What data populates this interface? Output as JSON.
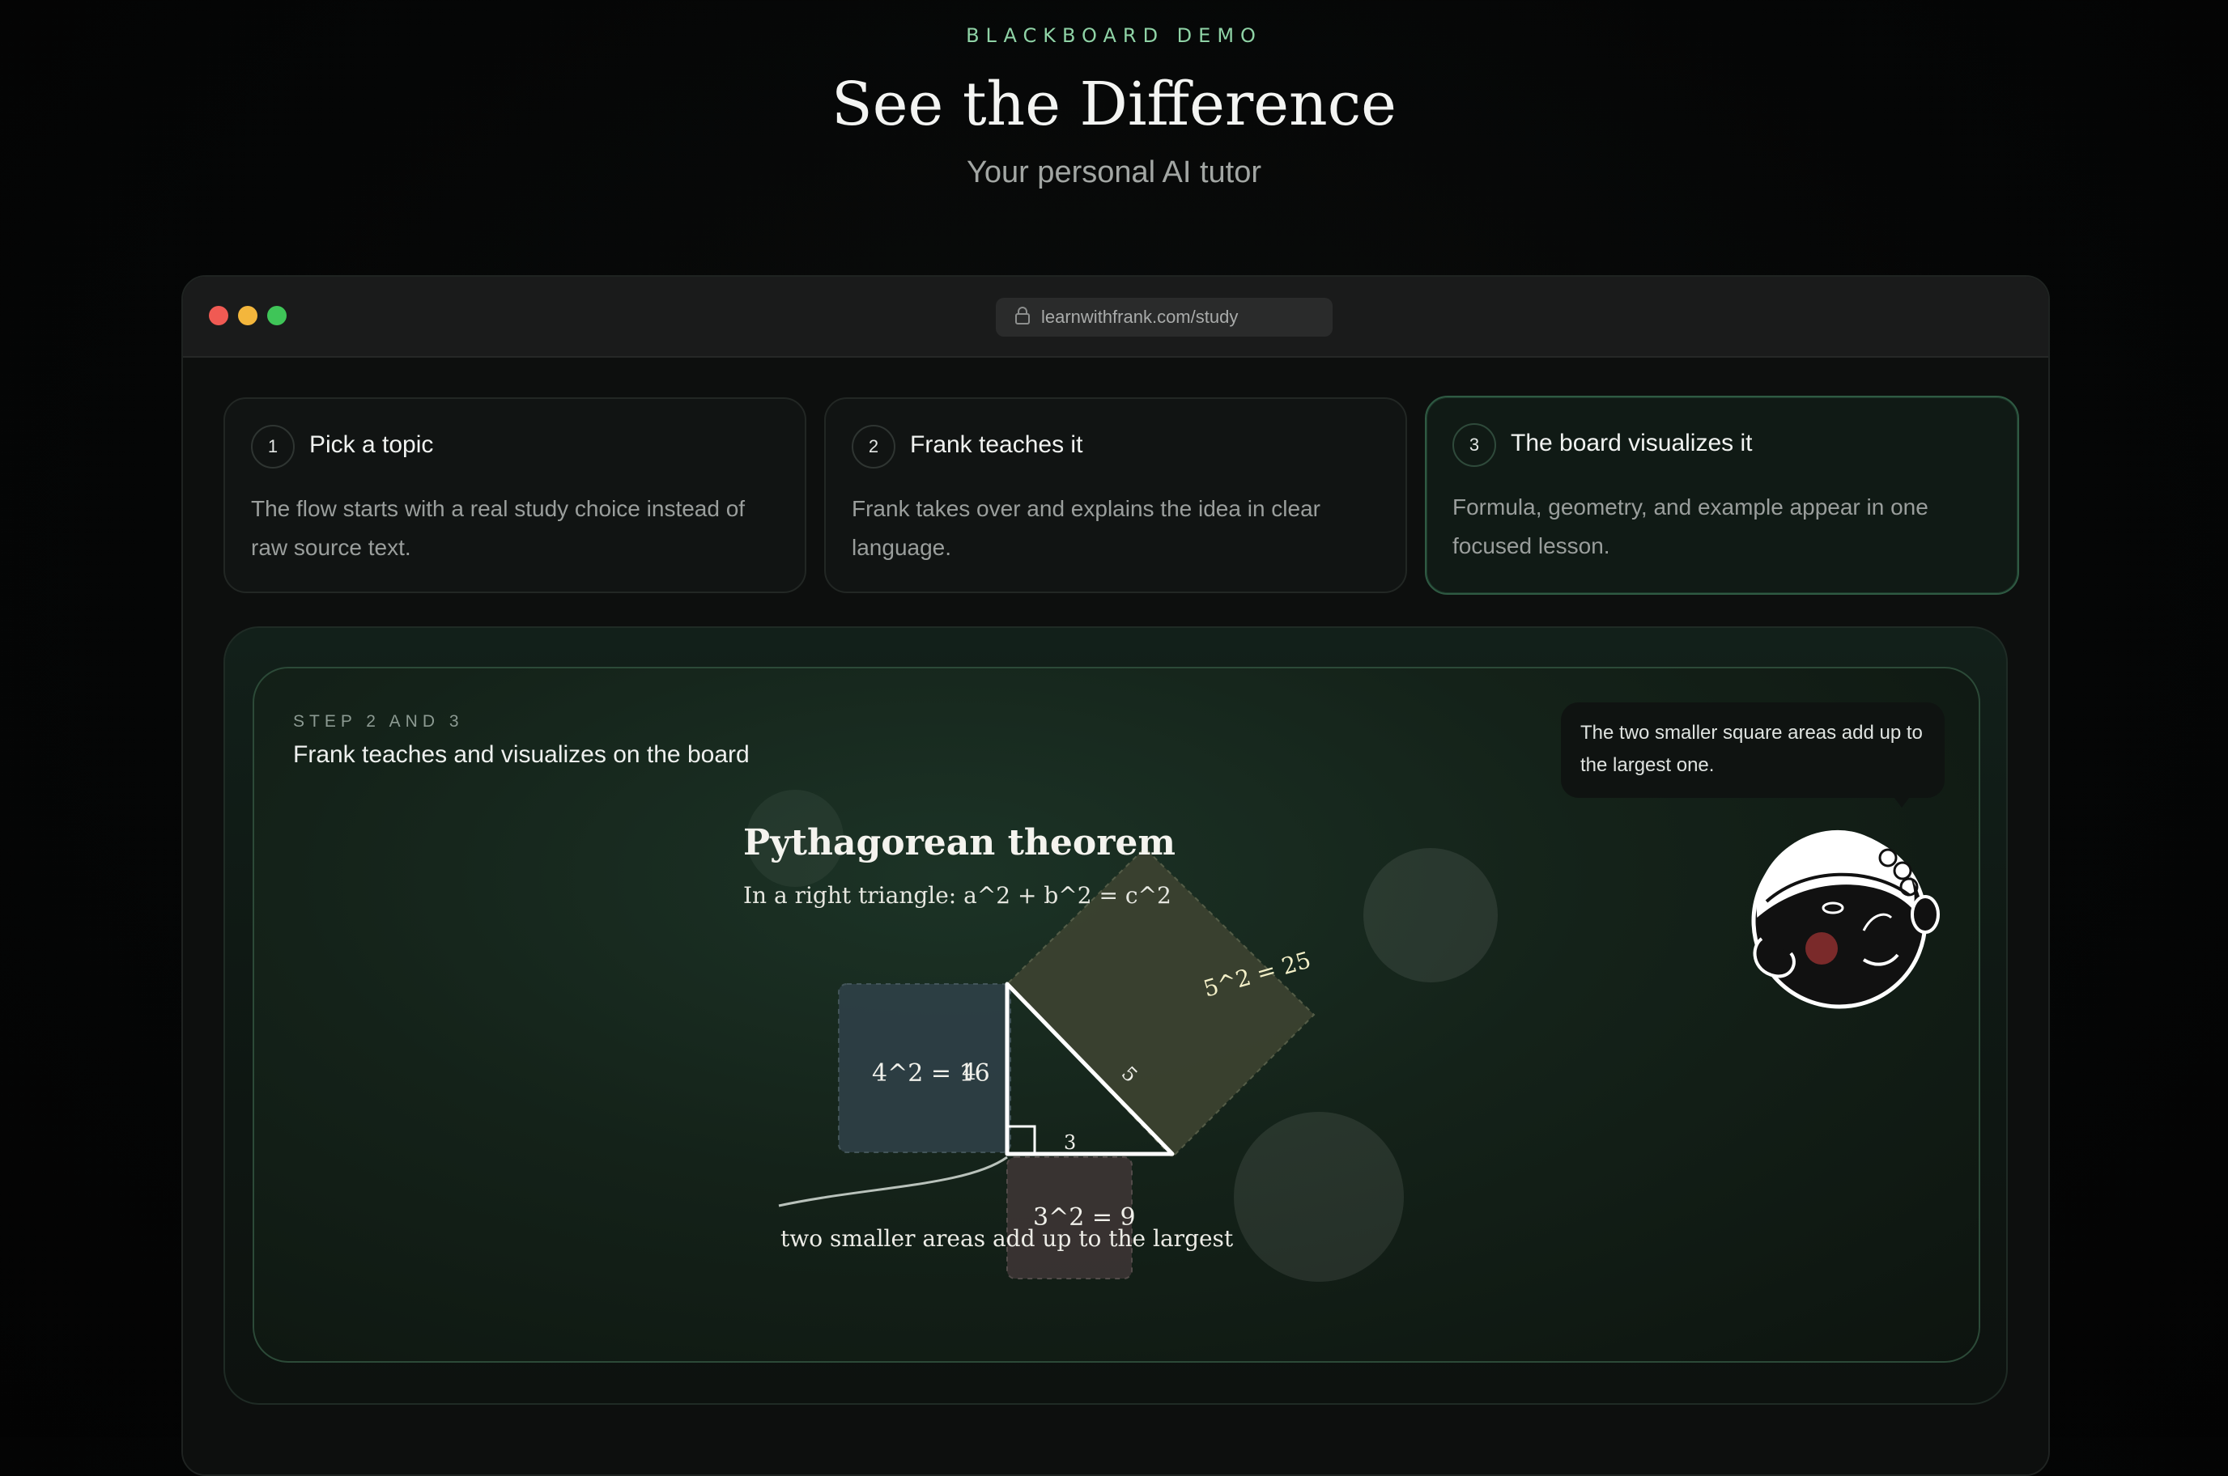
{
  "header": {
    "eyebrow": "BLACKBOARD DEMO",
    "title": "See the Difference",
    "subtitle": "Your personal AI tutor"
  },
  "browser": {
    "url": "learnwithfrank.com/study",
    "window_controls": [
      "close",
      "minimize",
      "maximize"
    ]
  },
  "steps": [
    {
      "number": "1",
      "title": "Pick a topic",
      "description": "The flow starts with a real study choice instead of raw source text.",
      "active": false
    },
    {
      "number": "2",
      "title": "Frank teaches it",
      "description": "Frank takes over and explains the idea in clear language.",
      "active": false
    },
    {
      "number": "3",
      "title": "The board visualizes it",
      "description": "Formula, geometry, and example appear in one focused lesson.",
      "active": true
    }
  ],
  "board": {
    "eyebrow": "STEP 2 AND 3",
    "heading": "Frank teaches and visualizes on the board",
    "speech_bubble": "The two smaller square areas add up to the largest one.",
    "lesson": {
      "title": "Pythagorean theorem",
      "formula": "In a right triangle: a^2 + b^2 = c^2",
      "square_a_label": "4^2 = 16",
      "square_b_label": "3^2 = 9",
      "square_c_label": "5^2 = 25",
      "side_hypotenuse": "5",
      "side_vertical": "4",
      "side_horizontal": "3",
      "caption": "two smaller areas add up to the largest"
    },
    "tutor_avatar": "frank-avatar-icon"
  },
  "colors": {
    "accent": "#8fd3a6",
    "window_close": "#f05a53",
    "window_minimize": "#f3b63c",
    "window_maximize": "#3fc558",
    "square_a": "#2e3f45",
    "square_b": "#3a3433",
    "square_c": "#3b4230"
  }
}
